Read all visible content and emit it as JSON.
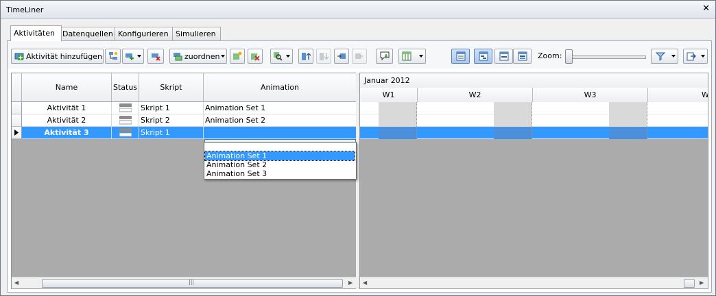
{
  "window": {
    "title": "TimeLiner"
  },
  "tabs": [
    {
      "label": "Aktivitäten",
      "active": true
    },
    {
      "label": "Datenquellen",
      "active": false
    },
    {
      "label": "Konfigurieren",
      "active": false
    },
    {
      "label": "Simulieren",
      "active": false
    }
  ],
  "toolbar": {
    "add_activity_label": "Aktivität hinzufügen",
    "assign_label": "zuordnen",
    "zoom_label": "Zoom:",
    "zoom_level": 0
  },
  "grid": {
    "columns": [
      "Name",
      "Status",
      "Skript",
      "Animation"
    ],
    "rows": [
      {
        "name": "Aktivität 1",
        "script": "Skript 1",
        "animation": "Animation Set 1",
        "selected": false
      },
      {
        "name": "Aktivität 2",
        "script": "Skript 2",
        "animation": "Animation Set 2",
        "selected": false
      },
      {
        "name": "Aktivität 3",
        "script": "Skript 1",
        "animation": "",
        "selected": true
      }
    ],
    "dropdown_options": [
      "Animation Set 1",
      "Animation Set 2",
      "Animation Set 3"
    ],
    "dropdown_highlighted": 0
  },
  "gantt": {
    "month": "Januar 2012",
    "weeks": [
      "W1",
      "W2",
      "W3",
      "W"
    ]
  },
  "colors": {
    "selection": "#3399ff",
    "empty_area": "#ababab",
    "pressed": "#a9c9ef"
  }
}
